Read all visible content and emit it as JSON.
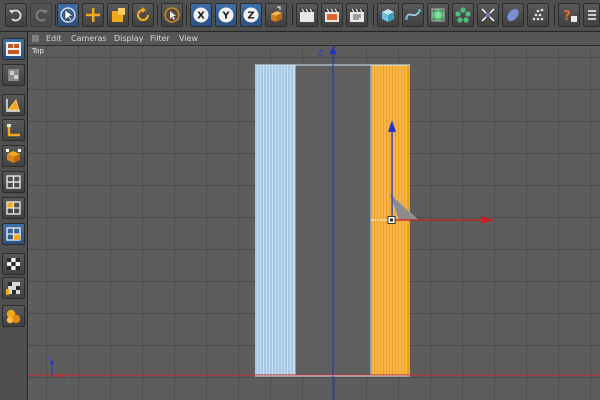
{
  "menu": {
    "edit": "Edit",
    "cameras": "Cameras",
    "display": "Display",
    "filter": "Filter",
    "view": "View"
  },
  "viewport": {
    "label": "Top",
    "z_axis_label": "Z",
    "mini_axis_z": "z",
    "mini_axis_x": "x"
  },
  "icons": {
    "toolbar": [
      "undo-icon",
      "redo-icon",
      "live-select-icon",
      "move-icon",
      "scale-icon",
      "rotate-icon",
      "recent-tool-icon",
      "x-axis-lock-icon",
      "y-axis-lock-icon",
      "z-axis-lock-icon",
      "coordinate-system-icon",
      "render-view-icon",
      "render-to-picture-viewer-icon",
      "render-settings-icon",
      "cube-icon",
      "spline-icon",
      "nurbs-icon",
      "array-icon",
      "deformer-icon",
      "scene-object-icon",
      "environment-icon",
      "help-icon",
      "more-icon"
    ],
    "left_toolbar": [
      "layout-icon",
      "checkerboard-icon",
      "model-mode-icon",
      "object-axis-icon",
      "points-mode-icon",
      "edges-mode-icon",
      "polygons-mode-icon",
      "uv-mode-icon",
      "texture-icon",
      "workplane-icon",
      "snap-icon"
    ]
  },
  "colors": {
    "active_blue": "#3f6fa8",
    "axis_x_red": "#d22020",
    "axis_y_blue": "#2035c8",
    "selected_orange": "#f0a020",
    "unselected_lightblue": "#b6d8f5"
  }
}
